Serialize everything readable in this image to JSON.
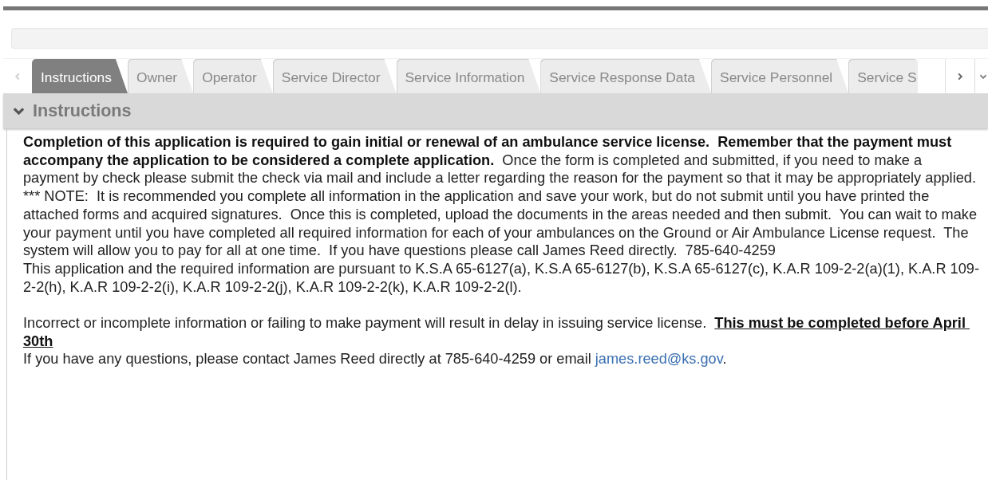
{
  "tabs": [
    {
      "label": "Instructions",
      "selected": true
    },
    {
      "label": "Owner",
      "selected": false
    },
    {
      "label": "Operator",
      "selected": false
    },
    {
      "label": "Service Director",
      "selected": false
    },
    {
      "label": "Service Information",
      "selected": false
    },
    {
      "label": "Service Response Data",
      "selected": false
    },
    {
      "label": "Service Personnel",
      "selected": false
    },
    {
      "label": "Service S",
      "selected": false
    }
  ],
  "section": {
    "title": "Instructions",
    "expanded": true,
    "paragraphs": [
      {
        "kind": "text",
        "text": "**Completion of this application is required to gain initial or renewal of an ambulance service license.  Remember that the payment must accompany the application to be considered a complete application.**  Once the form is completed and submitted, if you need to make a payment by check please submit the check via mail and include a letter regarding the reason for the payment so that it may be appropriately applied."
      },
      {
        "kind": "text",
        "text": "*** NOTE:  It is recommended you complete all information in the application and save your work, but do not submit until you have printed the attached forms and acquired signatures.  Once this is completed, upload the documents in the areas needed and then submit.  You can wait to make your payment until you have completed all required information for each of your ambulances on the Ground or Air Ambulance License request.  The system will allow you to pay for all at one time.  If you have questions please call James Reed directly.  785-640-4259"
      },
      {
        "kind": "text",
        "text": "This application and the required information are pursuant to K.S.A 65-6127(a), K.S.A 65-6127(b), K.S.A 65-6127(c), K.A.R 109-2-2(a)(1), K.A.R 109-2-2(h), K.A.R 109-2-2(i), K.A.R 109-2-2(j), K.A.R 109-2-2(k), K.A.R 109-2-2(l)."
      },
      {
        "kind": "gap"
      },
      {
        "kind": "underlined",
        "text": "Incorrect or incomplete information or failing to make payment will result in delay in issuing service license.  **This must be completed before April 30th**"
      },
      {
        "kind": "contact",
        "text": "If you have any questions, please contact James Reed directly at 785-640-4259 or email ",
        "link": "james.reed@ks.gov",
        "after": "."
      }
    ]
  }
}
